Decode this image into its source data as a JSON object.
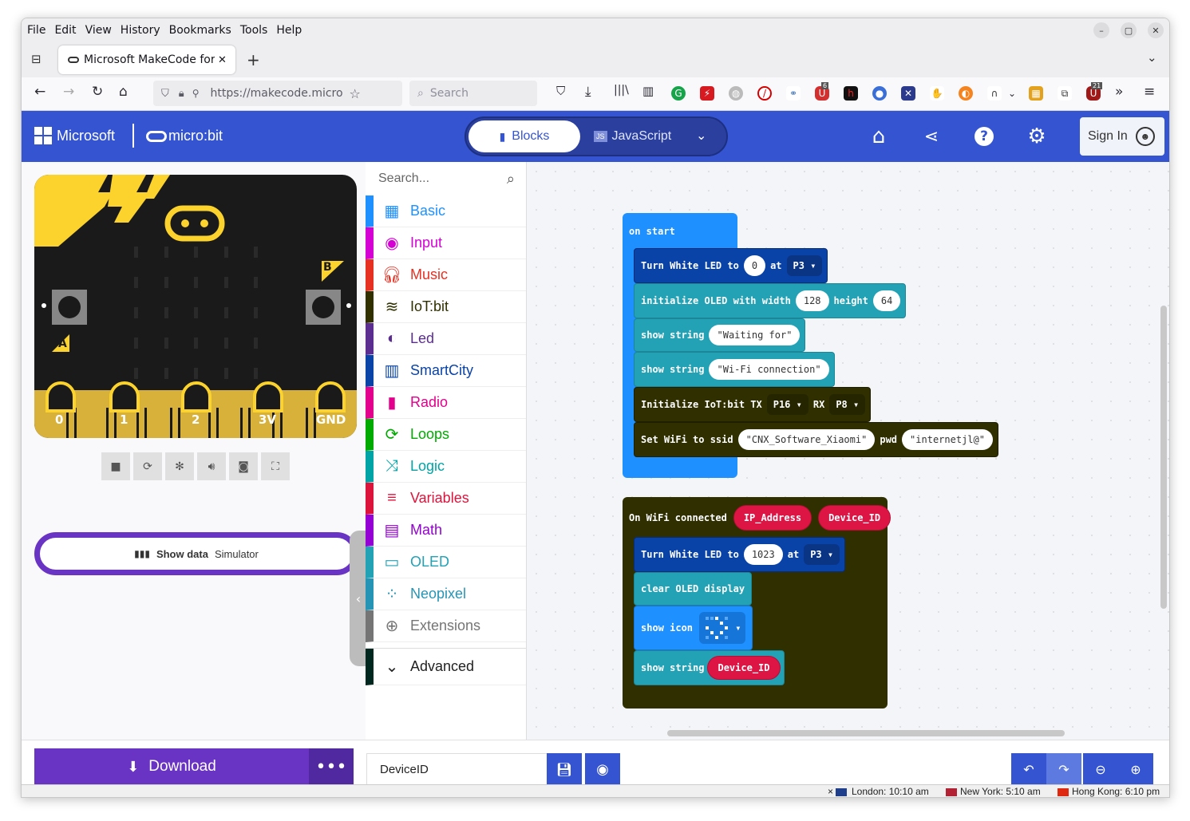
{
  "menu": [
    "File",
    "Edit",
    "View",
    "History",
    "Bookmarks",
    "Tools",
    "Help"
  ],
  "menu_accel": [
    "F",
    "E",
    "V",
    "s",
    "B",
    "T",
    "H"
  ],
  "tab": {
    "title": "Microsoft MakeCode for"
  },
  "url": "https://makecode.micro",
  "search_placeholder": "Search",
  "header": {
    "brand": "Microsoft",
    "product": "micro:bit",
    "blocks_label": "Blocks",
    "js_label": "JavaScript",
    "signin_label": "Sign In"
  },
  "simulator": {
    "pins": [
      "0",
      "1",
      "2",
      "3V",
      "GND"
    ],
    "button_a": "A",
    "button_b": "B",
    "show_data": "Show data",
    "show_data_suffix": "Simulator"
  },
  "toolbox": {
    "search_placeholder": "Search...",
    "categories": [
      {
        "label": "Basic",
        "color": "#1e90ff"
      },
      {
        "label": "Input",
        "color": "#d400d4"
      },
      {
        "label": "Music",
        "color": "#e63022"
      },
      {
        "label": "IoT:bit",
        "color": "#2f2f00"
      },
      {
        "label": "Led",
        "color": "#5c2d91"
      },
      {
        "label": "SmartCity",
        "color": "#0a43a8"
      },
      {
        "label": "Radio",
        "color": "#e3008c"
      },
      {
        "label": "Loops",
        "color": "#00aa00"
      },
      {
        "label": "Logic",
        "color": "#00a4a6"
      },
      {
        "label": "Variables",
        "color": "#dc143c"
      },
      {
        "label": "Math",
        "color": "#9400d3"
      },
      {
        "label": "OLED",
        "color": "#23a1b5"
      },
      {
        "label": "Neopixel",
        "color": "#2695b5"
      },
      {
        "label": "Extensions",
        "color": "#757575"
      }
    ],
    "advanced": "Advanced"
  },
  "blocks": {
    "on_start": "on start",
    "led1": {
      "text": "Turn White LED to",
      "value": "0",
      "at": "at",
      "pin": "P3"
    },
    "oled_init": {
      "text": "initialize OLED with width",
      "width": "128",
      "height_label": "height",
      "height": "64"
    },
    "show1": {
      "text": "show string",
      "value": "Waiting for"
    },
    "show2": {
      "text": "show string",
      "value": "Wi-Fi connection"
    },
    "iot_init": {
      "text": "Initialize IoT:bit TX",
      "tx": "P16",
      "rx_label": "RX",
      "rx": "P8"
    },
    "wifi": {
      "text": "Set WiFi to ssid",
      "ssid": "CNX_Software_Xiaomi",
      "pwd_label": "pwd",
      "pwd": "internetjl@"
    },
    "on_wifi": {
      "text": "On WiFi connected",
      "arg1": "IP_Address",
      "arg2": "Device_ID"
    },
    "led2": {
      "text": "Turn White LED to",
      "value": "1023",
      "at": "at",
      "pin": "P3"
    },
    "clear": "clear OLED display",
    "show_icon": "show icon",
    "show3": {
      "text": "show string",
      "value": "Device_ID"
    }
  },
  "bottom": {
    "download": "Download",
    "project_name": "DeviceID"
  },
  "statusbar": {
    "london": "London: 10:10 am",
    "newyork": "New York: 5:10 am",
    "hongkong": "Hong Kong: 6:10 pm"
  },
  "badges": {
    "ext_count1": "6",
    "ext_count2": "21"
  }
}
